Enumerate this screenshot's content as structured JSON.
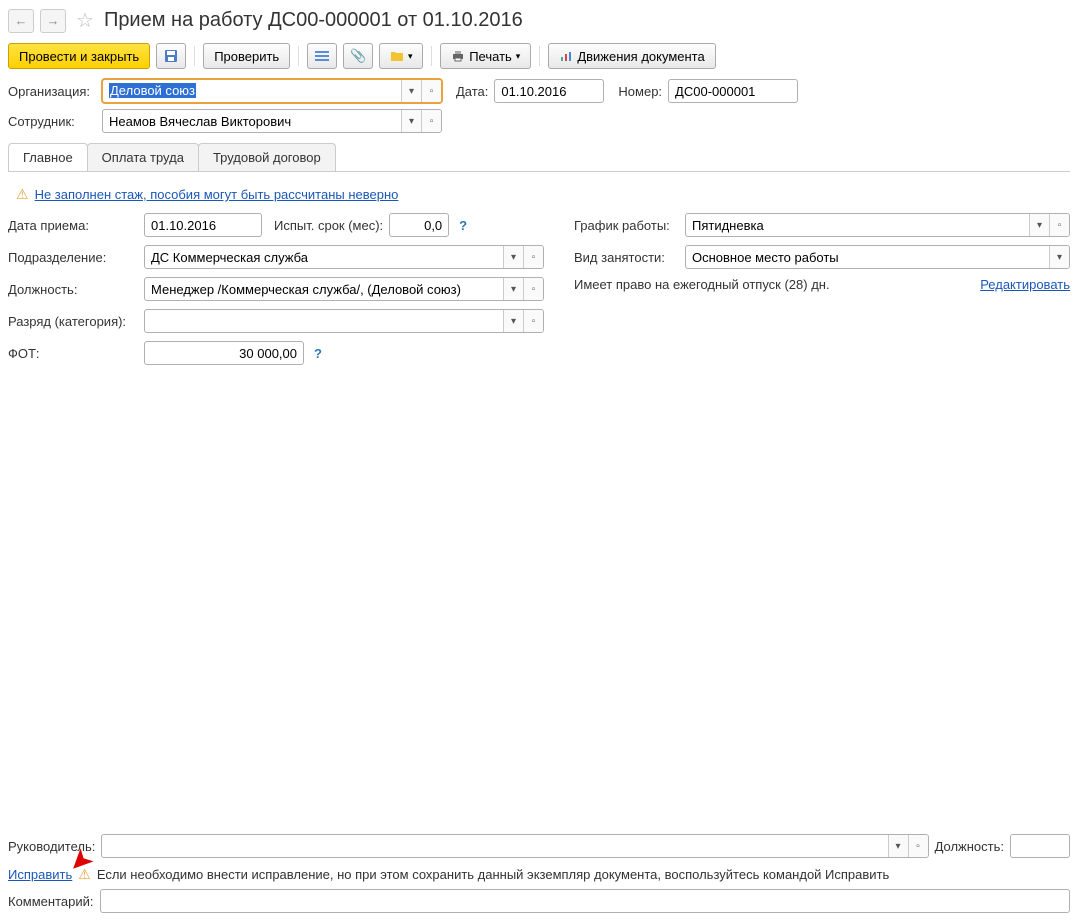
{
  "header": {
    "title": "Прием на работу ДС00-000001 от 01.10.2016"
  },
  "toolbar": {
    "submit_close": "Провести и закрыть",
    "check": "Проверить",
    "print": "Печать",
    "movements": "Движения документа"
  },
  "fields": {
    "org_label": "Организация:",
    "org_value": "Деловой союз",
    "date_label": "Дата:",
    "date_value": "01.10.2016",
    "number_label": "Номер:",
    "number_value": "ДС00-000001",
    "employee_label": "Сотрудник:",
    "employee_value": "Неамов Вячеслав Викторович"
  },
  "tabs": {
    "main": "Главное",
    "pay": "Оплата труда",
    "contract": "Трудовой договор"
  },
  "warning": {
    "text": "Не заполнен стаж, пособия могут быть рассчитаны неверно"
  },
  "main_tab": {
    "hire_date_label": "Дата приема:",
    "hire_date_value": "01.10.2016",
    "trial_label": "Испыт. срок (мес):",
    "trial_value": "0,0",
    "department_label": "Подразделение:",
    "department_value": "ДС Коммерческая служба",
    "position_label": "Должность:",
    "position_value": "Менеджер /Коммерческая служба/, (Деловой союз)",
    "rank_label": "Разряд (категория):",
    "rank_value": "",
    "fot_label": "ФОТ:",
    "fot_value": "30 000,00",
    "schedule_label": "График работы:",
    "schedule_value": "Пятидневка",
    "employment_label": "Вид занятости:",
    "employment_value": "Основное место работы",
    "vacation_text": "Имеет право на ежегодный отпуск (28) дн.",
    "edit_link": "Редактировать"
  },
  "footer": {
    "manager_label": "Руководитель:",
    "manager_value": "",
    "position_label": "Должность:",
    "position_value": "",
    "fix_link": "Исправить",
    "fix_text": "Если необходимо внести исправление, но при этом сохранить данный экземпляр документа, воспользуйтесь командой Исправить",
    "comment_label": "Комментарий:",
    "comment_value": ""
  }
}
